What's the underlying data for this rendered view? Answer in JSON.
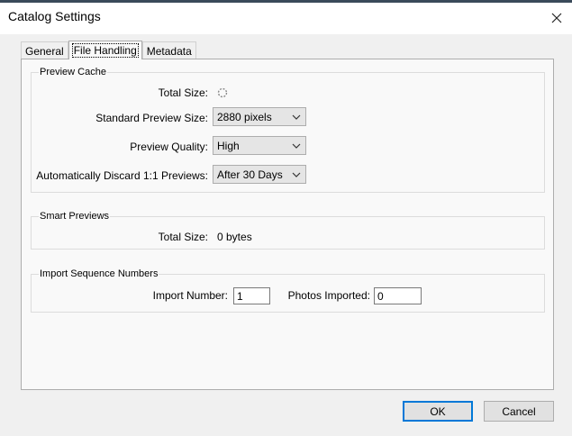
{
  "window": {
    "title": "Catalog Settings"
  },
  "tabs": [
    {
      "label": "General"
    },
    {
      "label": "File Handling"
    },
    {
      "label": "Metadata"
    }
  ],
  "preview_cache": {
    "legend": "Preview Cache",
    "total_size_label": "Total Size:",
    "standard_preview_size_label": "Standard Preview Size:",
    "standard_preview_size_value": "2880 pixels",
    "preview_quality_label": "Preview Quality:",
    "preview_quality_value": "High",
    "auto_discard_label": "Automatically Discard 1:1 Previews:",
    "auto_discard_value": "After 30 Days"
  },
  "smart_previews": {
    "legend": "Smart Previews",
    "total_size_label": "Total Size:",
    "total_size_value": "0 bytes"
  },
  "import_sequence": {
    "legend": "Import Sequence Numbers",
    "import_number_label": "Import Number:",
    "import_number_value": "1",
    "photos_imported_label": "Photos Imported:",
    "photos_imported_value": "0"
  },
  "buttons": {
    "ok": "OK",
    "cancel": "Cancel"
  }
}
